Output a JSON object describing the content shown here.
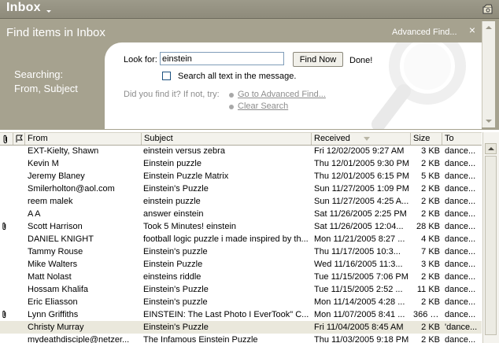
{
  "titlebar": {
    "title": "Inbox",
    "icon_right": "folder-options-icon"
  },
  "find_pane": {
    "header": "Find items in Inbox",
    "advanced_find": "Advanced Find...",
    "close_label": "×",
    "searching_label": "Searching:",
    "searching_fields": "From, Subject",
    "look_for_label": "Look for:",
    "look_for_value": "einstein",
    "find_now_label": "Find Now",
    "status_text": "Done!",
    "search_all_text_label": "Search all text in the message.",
    "search_all_text_checked": false,
    "did_you_find_label": "Did you find it? If not, try:",
    "links": {
      "go_to_advanced": "Go to Advanced Find...",
      "clear_search": "Clear Search"
    }
  },
  "columns": {
    "attachment": "",
    "flag": "",
    "from": "From",
    "subject": "Subject",
    "received": "Received",
    "size": "Size",
    "to": "To"
  },
  "messages": [
    {
      "attachment": false,
      "from": "EXT-Kielty, Shawn",
      "subject": "einstein versus zebra",
      "received": "Fri 12/02/2005 9:27 AM",
      "size": "3 KB",
      "to": "dance..."
    },
    {
      "attachment": false,
      "from": "Kevin M",
      "subject": "Einstein puzzle",
      "received": "Thu 12/01/2005 9:30 PM",
      "size": "2 KB",
      "to": "dance..."
    },
    {
      "attachment": false,
      "from": "Jeremy Blaney",
      "subject": "Einstein Puzzle Matrix",
      "received": "Thu 12/01/2005 6:15 PM",
      "size": "5 KB",
      "to": "dance..."
    },
    {
      "attachment": false,
      "from": "Smilerholton@aol.com",
      "subject": "Einstein's Puzzle",
      "received": "Sun 11/27/2005 1:09 PM",
      "size": "2 KB",
      "to": "dance..."
    },
    {
      "attachment": false,
      "from": "reem malek",
      "subject": "einstein puzzle",
      "received": "Sun 11/27/2005 4:25 A...",
      "size": "2 KB",
      "to": "dance..."
    },
    {
      "attachment": false,
      "from": "A A",
      "subject": "answer einstein",
      "received": "Sat 11/26/2005 2:25 PM",
      "size": "2 KB",
      "to": "dance..."
    },
    {
      "attachment": true,
      "from": "Scott Harrison",
      "subject": "Took 5 Minutes! einstein",
      "received": "Sat 11/26/2005 12:04...",
      "size": "28 KB",
      "to": "dance..."
    },
    {
      "attachment": false,
      "from": "DANIEL KNIGHT",
      "subject": "football logic puzzle i made inspired by th...",
      "received": "Mon 11/21/2005 8:27 ...",
      "size": "4 KB",
      "to": "dance..."
    },
    {
      "attachment": false,
      "from": "Tammy Rouse",
      "subject": "Einstein's puzzle",
      "received": "Thu 11/17/2005 10:3...",
      "size": "7 KB",
      "to": "dance..."
    },
    {
      "attachment": false,
      "from": "Mike Walters",
      "subject": "Einstein Puzzle",
      "received": "Wed 11/16/2005 11:3...",
      "size": "3 KB",
      "to": "dance..."
    },
    {
      "attachment": false,
      "from": "Matt Nolast",
      "subject": "einsteins riddle",
      "received": "Tue 11/15/2005 7:06 PM",
      "size": "2 KB",
      "to": "dance..."
    },
    {
      "attachment": false,
      "from": "Hossam Khalifa",
      "subject": "Einstein's Puzzle",
      "received": "Tue 11/15/2005 2:52 ...",
      "size": "11 KB",
      "to": "dance..."
    },
    {
      "attachment": false,
      "from": "Eric Eliasson",
      "subject": "Einstein's puzzle",
      "received": "Mon 11/14/2005 4:28 ...",
      "size": "2 KB",
      "to": "dance..."
    },
    {
      "attachment": true,
      "from": "Lynn Griffiths",
      "subject": "EINSTEIN: The Last Photo I EverTook\" C...",
      "received": "Mon 11/07/2005 8:41 ...",
      "size": "366 KB",
      "to": "dance..."
    },
    {
      "attachment": false,
      "from": "Christy Murray",
      "subject": "Einstein's Puzzle",
      "received": "Fri 11/04/2005 8:45 AM",
      "size": "2 KB",
      "to": "'dance...",
      "selected": true
    },
    {
      "attachment": false,
      "from": "mydeathdisciple@netzer...",
      "subject": "The Infamous Einstein Puzzle",
      "received": "Thu 11/03/2005 9:18 PM",
      "size": "2 KB",
      "to": "dance..."
    }
  ],
  "colors": {
    "titlebar": "#9d9a8a",
    "find_pane": "#a6a28f",
    "link_gray": "#8d8d8d",
    "selected_row": "#eae8dc"
  }
}
